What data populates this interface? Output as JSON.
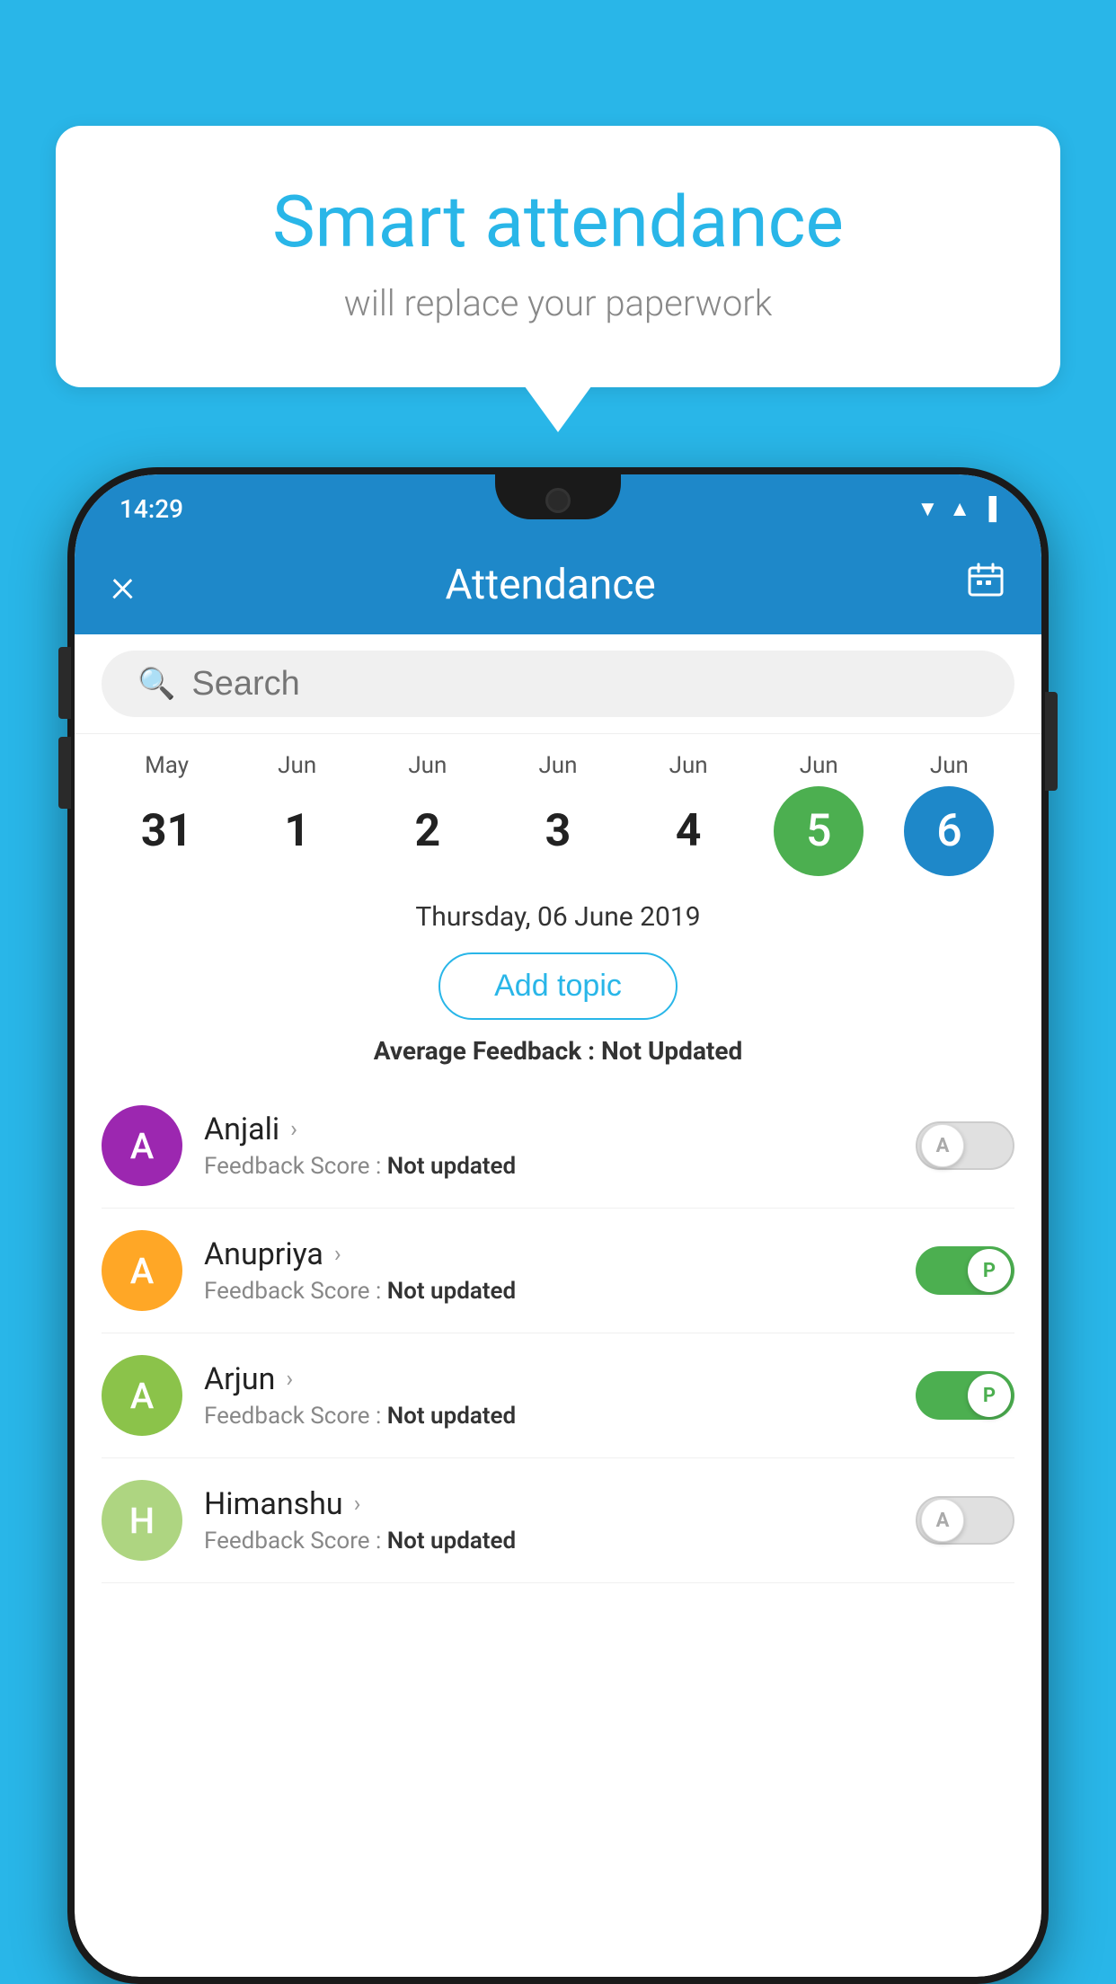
{
  "background_color": "#29b6e8",
  "speech_bubble": {
    "title": "Smart attendance",
    "subtitle": "will replace your paperwork"
  },
  "status_bar": {
    "time": "14:29",
    "icons": [
      "wifi",
      "signal",
      "battery"
    ]
  },
  "app_bar": {
    "close_label": "×",
    "title": "Attendance",
    "calendar_icon": "📅"
  },
  "search": {
    "placeholder": "Search"
  },
  "date_selector": {
    "dates": [
      {
        "month": "May",
        "day": "31",
        "highlight": "none"
      },
      {
        "month": "Jun",
        "day": "1",
        "highlight": "none"
      },
      {
        "month": "Jun",
        "day": "2",
        "highlight": "none"
      },
      {
        "month": "Jun",
        "day": "3",
        "highlight": "none"
      },
      {
        "month": "Jun",
        "day": "4",
        "highlight": "none"
      },
      {
        "month": "Jun",
        "day": "5",
        "highlight": "green"
      },
      {
        "month": "Jun",
        "day": "6",
        "highlight": "blue"
      }
    ]
  },
  "selected_date_label": "Thursday, 06 June 2019",
  "add_topic_button": "Add topic",
  "average_feedback_label": "Average Feedback :",
  "average_feedback_value": "Not Updated",
  "students": [
    {
      "name": "Anjali",
      "avatar_letter": "A",
      "avatar_color": "#9c27b0",
      "feedback_label": "Feedback Score :",
      "feedback_value": "Not updated",
      "toggle": "off",
      "toggle_letter": "A"
    },
    {
      "name": "Anupriya",
      "avatar_letter": "A",
      "avatar_color": "#ffa726",
      "feedback_label": "Feedback Score :",
      "feedback_value": "Not updated",
      "toggle": "on",
      "toggle_letter": "P"
    },
    {
      "name": "Arjun",
      "avatar_letter": "A",
      "avatar_color": "#8bc34a",
      "feedback_label": "Feedback Score :",
      "feedback_value": "Not updated",
      "toggle": "on",
      "toggle_letter": "P"
    },
    {
      "name": "Himanshu",
      "avatar_letter": "H",
      "avatar_color": "#aed581",
      "feedback_label": "Feedback Score :",
      "feedback_value": "Not updated",
      "toggle": "off",
      "toggle_letter": "A"
    }
  ]
}
